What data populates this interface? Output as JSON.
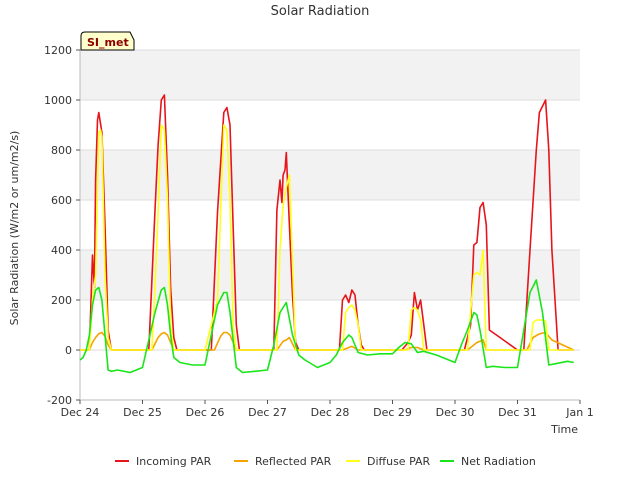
{
  "chart_data": {
    "type": "line",
    "title": "Solar Radiation",
    "xlabel": "Time",
    "ylabel": "Solar Radiation (W/m2 or um/m2/s)",
    "station_label": "SI_met",
    "ylim": [
      -200,
      1200
    ],
    "yticks": [
      -200,
      0,
      200,
      400,
      600,
      800,
      1000,
      1200
    ],
    "xlim": [
      0,
      8
    ],
    "x_unit": "days from Dec 24",
    "x_tick_labels": [
      "Dec 24",
      "Dec 25",
      "Dec 26",
      "Dec 27",
      "Dec 28",
      "Dec 29",
      "Dec 30",
      "Dec 31",
      "Jan 1"
    ],
    "x_tick_values": [
      0,
      1,
      2,
      3,
      4,
      5,
      6,
      7,
      8
    ],
    "grid": true,
    "legend_position": "bottom",
    "colors": {
      "Incoming PAR": "#e8141b",
      "Reflected PAR": "#f5a300",
      "Diffuse PAR": "#ffff1a",
      "Net Radiation": "#1ae51a"
    },
    "series": [
      {
        "name": "Incoming PAR",
        "x": [
          0,
          0.15,
          0.2,
          0.23,
          0.25,
          0.28,
          0.3,
          0.35,
          0.4,
          0.45,
          0.5,
          0.55,
          1.0,
          1.1,
          1.2,
          1.25,
          1.3,
          1.35,
          1.4,
          1.45,
          1.5,
          1.55,
          2.0,
          2.1,
          2.2,
          2.3,
          2.35,
          2.4,
          2.45,
          2.5,
          2.55,
          3.0,
          3.1,
          3.15,
          3.2,
          3.23,
          3.25,
          3.28,
          3.3,
          3.35,
          3.4,
          3.45,
          3.5,
          4.0,
          4.15,
          4.2,
          4.25,
          4.3,
          4.35,
          4.4,
          4.45,
          4.5,
          4.55,
          5.0,
          5.15,
          5.25,
          5.3,
          5.35,
          5.4,
          5.45,
          5.5,
          5.55,
          6.0,
          6.15,
          6.25,
          6.3,
          6.35,
          6.4,
          6.45,
          6.5,
          6.55,
          7.0,
          7.1,
          7.2,
          7.3,
          7.35,
          7.45,
          7.5,
          7.55,
          7.65,
          7.9
        ],
        "y": [
          0,
          0,
          380,
          250,
          680,
          920,
          950,
          870,
          500,
          80,
          0,
          0,
          0,
          0,
          560,
          820,
          1000,
          1020,
          700,
          250,
          50,
          0,
          0,
          0,
          550,
          950,
          970,
          900,
          500,
          100,
          0,
          0,
          0,
          560,
          680,
          590,
          700,
          720,
          790,
          500,
          220,
          30,
          0,
          0,
          0,
          200,
          220,
          190,
          240,
          220,
          100,
          20,
          0,
          0,
          0,
          30,
          60,
          230,
          160,
          200,
          100,
          0,
          0,
          0,
          100,
          420,
          430,
          570,
          590,
          500,
          80,
          0,
          0,
          400,
          800,
          950,
          1000,
          800,
          400,
          0,
          0
        ]
      },
      {
        "name": "Reflected PAR",
        "x": [
          0,
          0.15,
          0.2,
          0.25,
          0.3,
          0.35,
          0.4,
          0.45,
          0.5,
          1.0,
          1.15,
          1.25,
          1.3,
          1.35,
          1.4,
          1.5,
          2.0,
          2.15,
          2.25,
          2.3,
          2.35,
          2.4,
          2.5,
          3.0,
          3.15,
          3.25,
          3.3,
          3.35,
          3.45,
          4.0,
          4.2,
          4.3,
          4.35,
          4.45,
          5.0,
          5.2,
          5.3,
          5.4,
          5.5,
          6.0,
          6.2,
          6.3,
          6.35,
          6.45,
          6.5,
          7.0,
          7.15,
          7.25,
          7.35,
          7.45,
          7.55,
          7.9
        ],
        "y": [
          0,
          0,
          30,
          50,
          65,
          70,
          55,
          20,
          0,
          0,
          0,
          50,
          65,
          70,
          60,
          0,
          0,
          0,
          55,
          70,
          70,
          60,
          0,
          0,
          0,
          35,
          40,
          50,
          0,
          0,
          0,
          10,
          15,
          0,
          0,
          0,
          10,
          10,
          0,
          0,
          0,
          20,
          30,
          40,
          0,
          0,
          0,
          50,
          65,
          70,
          40,
          0
        ]
      },
      {
        "name": "Diffuse PAR",
        "x": [
          0,
          0.15,
          0.2,
          0.25,
          0.3,
          0.33,
          0.35,
          0.4,
          0.45,
          0.5,
          1.0,
          1.15,
          1.2,
          1.25,
          1.3,
          1.35,
          1.4,
          1.45,
          1.5,
          2.0,
          2.2,
          2.25,
          2.3,
          2.35,
          2.4,
          2.45,
          2.5,
          3.0,
          3.15,
          3.2,
          3.25,
          3.3,
          3.35,
          3.4,
          3.45,
          4.0,
          4.2,
          4.25,
          4.3,
          4.35,
          4.4,
          4.45,
          4.5,
          5.0,
          5.25,
          5.3,
          5.35,
          5.4,
          5.45,
          5.5,
          6.0,
          6.2,
          6.25,
          6.3,
          6.35,
          6.4,
          6.45,
          6.5,
          7.0,
          7.2,
          7.25,
          7.3,
          7.4,
          7.45,
          7.5,
          7.9
        ],
        "y": [
          0,
          0,
          200,
          300,
          870,
          880,
          850,
          300,
          50,
          0,
          0,
          0,
          250,
          550,
          900,
          880,
          600,
          100,
          0,
          0,
          200,
          550,
          900,
          880,
          600,
          100,
          0,
          0,
          0,
          400,
          580,
          650,
          700,
          350,
          0,
          0,
          0,
          150,
          170,
          180,
          160,
          100,
          0,
          0,
          0,
          160,
          170,
          160,
          120,
          0,
          0,
          0,
          150,
          300,
          310,
          300,
          400,
          0,
          0,
          0,
          110,
          120,
          120,
          115,
          0,
          0
        ]
      },
      {
        "name": "Net Radiation",
        "x": [
          0,
          0.05,
          0.1,
          0.15,
          0.2,
          0.25,
          0.3,
          0.35,
          0.4,
          0.45,
          0.5,
          0.6,
          0.8,
          1.0,
          1.1,
          1.2,
          1.3,
          1.35,
          1.4,
          1.45,
          1.5,
          1.6,
          1.8,
          2.0,
          2.1,
          2.2,
          2.3,
          2.35,
          2.4,
          2.5,
          2.6,
          2.8,
          3.0,
          3.1,
          3.2,
          3.25,
          3.3,
          3.4,
          3.5,
          3.6,
          3.8,
          4.0,
          4.1,
          4.2,
          4.3,
          4.35,
          4.45,
          4.6,
          4.8,
          5.0,
          5.1,
          5.2,
          5.3,
          5.4,
          5.5,
          5.7,
          6.0,
          6.1,
          6.2,
          6.3,
          6.35,
          6.4,
          6.5,
          6.6,
          6.8,
          7.0,
          7.1,
          7.2,
          7.3,
          7.4,
          7.5,
          7.6,
          7.8,
          7.9
        ],
        "y": [
          -40,
          -30,
          0,
          60,
          180,
          240,
          250,
          200,
          60,
          -80,
          -85,
          -80,
          -90,
          -70,
          40,
          150,
          240,
          250,
          180,
          60,
          -30,
          -50,
          -60,
          -60,
          60,
          180,
          230,
          230,
          150,
          -70,
          -90,
          -85,
          -80,
          20,
          150,
          170,
          190,
          60,
          -20,
          -40,
          -70,
          -50,
          -20,
          30,
          60,
          50,
          -10,
          -20,
          -15,
          -15,
          10,
          30,
          25,
          -10,
          -5,
          -20,
          -50,
          20,
          80,
          150,
          140,
          80,
          -70,
          -65,
          -70,
          -70,
          80,
          230,
          280,
          150,
          -60,
          -55,
          -45,
          -50
        ]
      }
    ]
  }
}
